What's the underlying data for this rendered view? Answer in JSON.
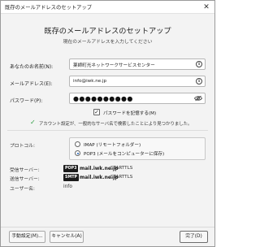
{
  "window": {
    "title": "既存のメールアドレスのセットアップ",
    "close_glyph": "✕"
  },
  "header": {
    "title": "既存のメールアドレスのセットアップ",
    "subtitle": "現在のメールアドレスを入力してください"
  },
  "form": {
    "name_label": "あなたのお名前(N):",
    "name_value": "薬師町光ネットワークサービスセンター",
    "email_label": "メールアドレス(E):",
    "email_value": "info@iwk.ne.jp",
    "password_label": "パスワード(P):",
    "password_mask": "●●●●●●●●●●",
    "remember_checked": true,
    "remember_label": "パスワードを記憶する(M)",
    "info_glyph": "i",
    "check_glyph": "✓"
  },
  "status": {
    "check_glyph": "✓",
    "message": "アカウント設定が、一般的なサーバ名で検索したことにより見つかりました。"
  },
  "protocol": {
    "label": "プロトコル:",
    "options": [
      {
        "label": "IMAP (リモートフォルダー)",
        "selected": false
      },
      {
        "label": "POP3 (メールをコンピューターに保存)",
        "selected": true
      }
    ]
  },
  "servers": {
    "incoming_label": "受信サーバー:",
    "incoming_badge": "POP3",
    "incoming_host": "mail.iwk.ne.jp",
    "incoming_security": "STARTTLS",
    "outgoing_label": "送信サーバー:",
    "outgoing_badge": "SMTP",
    "outgoing_host": "mail.iwk.ne.jp",
    "outgoing_security": "STARTTLS",
    "username_label": "ユーザー名:",
    "username_value": "info"
  },
  "buttons": {
    "manual": "手動設定(M)...",
    "cancel": "キャンセル(A)",
    "done": "完了(D)"
  }
}
